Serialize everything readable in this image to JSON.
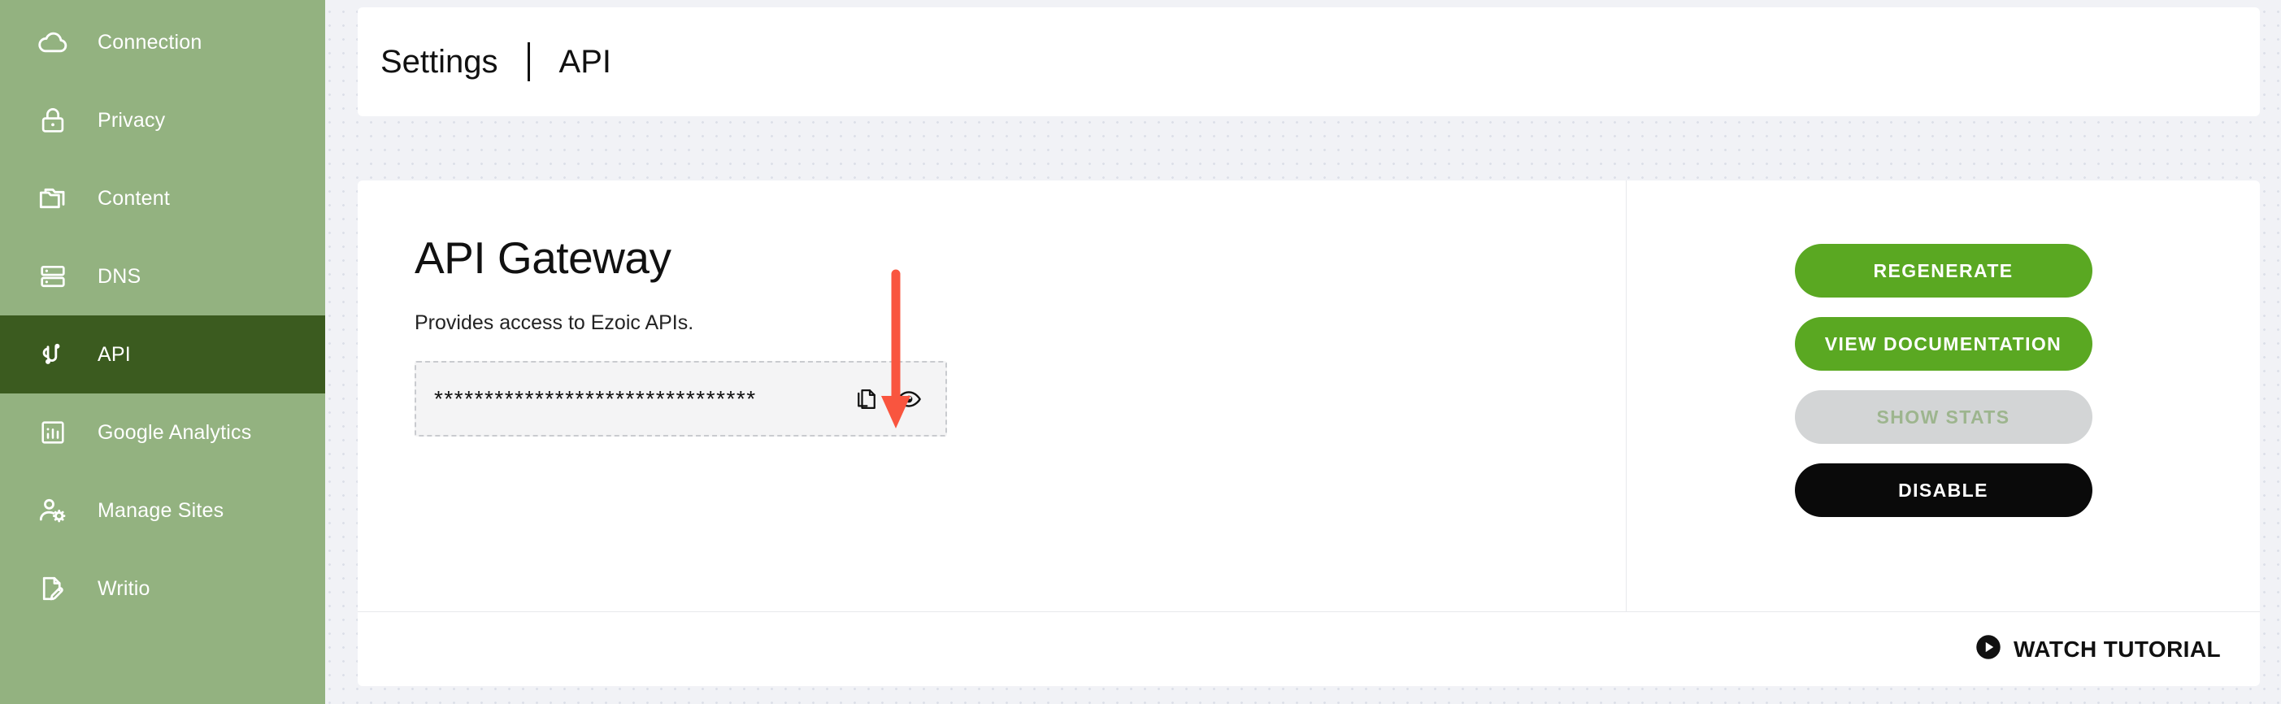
{
  "sidebar": {
    "items": [
      {
        "label": "Connection",
        "icon": "cloud-icon",
        "active": false
      },
      {
        "label": "Privacy",
        "icon": "lock-icon",
        "active": false
      },
      {
        "label": "Content",
        "icon": "folder-icon",
        "active": false
      },
      {
        "label": "DNS",
        "icon": "server-icon",
        "active": false
      },
      {
        "label": "API",
        "icon": "api-connector-icon",
        "active": true
      },
      {
        "label": "Google Analytics",
        "icon": "bar-chart-icon",
        "active": false
      },
      {
        "label": "Manage Sites",
        "icon": "user-settings-icon",
        "active": false
      },
      {
        "label": "Writio",
        "icon": "document-edit-icon",
        "active": false
      }
    ]
  },
  "header": {
    "breadcrumb": {
      "parent": "Settings",
      "current": "API"
    }
  },
  "main": {
    "title": "API Gateway",
    "description": "Provides access to Ezoic APIs.",
    "api_key": {
      "masked_value": "********************************",
      "copy_icon": "copy-icon",
      "reveal_icon": "eye-icon"
    },
    "actions": [
      {
        "label": "REGENERATE",
        "style": "green",
        "disabled": false
      },
      {
        "label": "VIEW DOCUMENTATION",
        "style": "green",
        "disabled": false
      },
      {
        "label": "SHOW STATS",
        "style": "disabled",
        "disabled": true
      },
      {
        "label": "DISABLE",
        "style": "black",
        "disabled": false
      }
    ],
    "footer": {
      "watch_tutorial_label": "WATCH TUTORIAL",
      "play_icon": "play-circle-icon"
    }
  },
  "annotation": {
    "type": "arrow",
    "direction": "down",
    "color": "#f9553f",
    "points_at": "copy-icon"
  },
  "colors": {
    "sidebar_bg": "#93b280",
    "sidebar_active_bg": "#3b5b1f",
    "page_bg": "#f1f2f6",
    "card_bg": "#ffffff",
    "accent_green": "#5aa822",
    "black_button": "#0a0a0a",
    "disabled_bg": "#d3d5d6",
    "disabled_text": "#9db58e",
    "annotation_red": "#f9553f"
  }
}
